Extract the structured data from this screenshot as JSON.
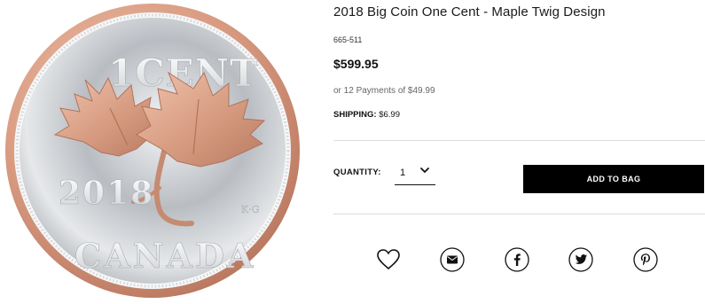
{
  "product": {
    "title": "2018 Big Coin One Cent - Maple Twig Design",
    "sku": "665-511",
    "price": "$599.95",
    "payments": "or 12 Payments of $49.99",
    "shipping_label": "SHIPPING:",
    "shipping_value": "$6.99"
  },
  "coin": {
    "denomination": "1CENT",
    "year": "2018",
    "initials": "K·G",
    "country": "CANADA"
  },
  "quantity": {
    "label": "QUANTITY:",
    "value": "1"
  },
  "actions": {
    "add_to_bag": "ADD TO BAG"
  },
  "icons": [
    "heart-icon",
    "email-icon",
    "facebook-icon",
    "twitter-icon",
    "pinterest-icon"
  ],
  "colors": {
    "button_bg": "#000000",
    "rose_gold": "#d9a28a",
    "silver": "#c9ccd0"
  }
}
